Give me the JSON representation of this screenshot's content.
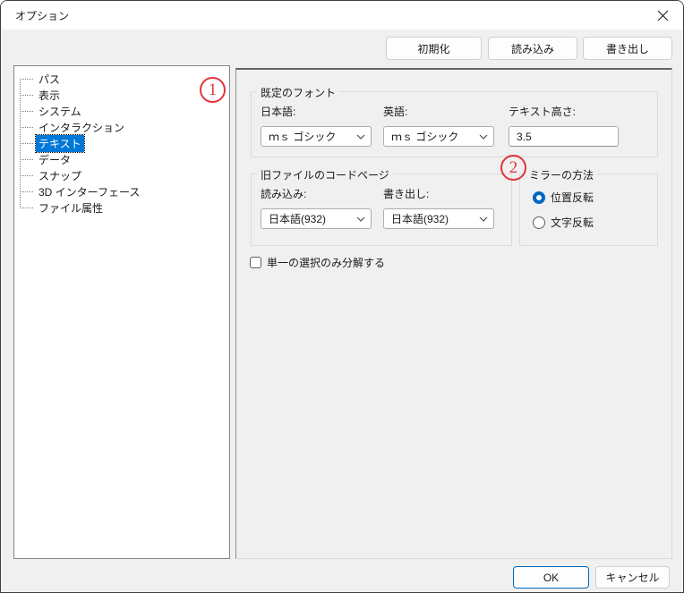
{
  "window": {
    "title": "オプション"
  },
  "toolbar": {
    "init_label": "初期化",
    "import_label": "読み込み",
    "export_label": "書き出し"
  },
  "tree": {
    "items": [
      {
        "label": "パス",
        "selected": false
      },
      {
        "label": "表示",
        "selected": false
      },
      {
        "label": "システム",
        "selected": false
      },
      {
        "label": "インタラクション",
        "selected": false
      },
      {
        "label": "テキスト",
        "selected": true
      },
      {
        "label": "データ",
        "selected": false
      },
      {
        "label": "スナップ",
        "selected": false
      },
      {
        "label": "3D インターフェース",
        "selected": false
      },
      {
        "label": "ファイル属性",
        "selected": false
      }
    ]
  },
  "annotations": {
    "one": "1",
    "two": "2"
  },
  "main": {
    "font_group": {
      "title": "既定のフォント",
      "japanese_label": "日本語:",
      "japanese_value": "ｍｓ ゴシック",
      "english_label": "英語:",
      "english_value": "ｍｓ ゴシック",
      "text_height_label": "テキスト高さ:",
      "text_height_value": "3.5"
    },
    "codepage_group": {
      "title": "旧ファイルのコードページ",
      "import_label": "読み込み:",
      "import_value": "日本語(932)",
      "export_label": "書き出し:",
      "export_value": "日本語(932)"
    },
    "mirror_group": {
      "title": "ミラーの方法",
      "options": [
        {
          "label": "位置反転",
          "selected": true
        },
        {
          "label": "文字反転",
          "selected": false
        }
      ]
    },
    "checkbox": {
      "label": "単一の選択のみ分解する",
      "checked": false
    }
  },
  "footer": {
    "ok_label": "OK",
    "cancel_label": "キャンセル"
  },
  "colors": {
    "accent": "#0067c0",
    "selection": "#0078d7",
    "annotation_red": "#e0353b",
    "dialog_bg": "#f0f0f0",
    "titlebar_bg": "#ffffff"
  }
}
